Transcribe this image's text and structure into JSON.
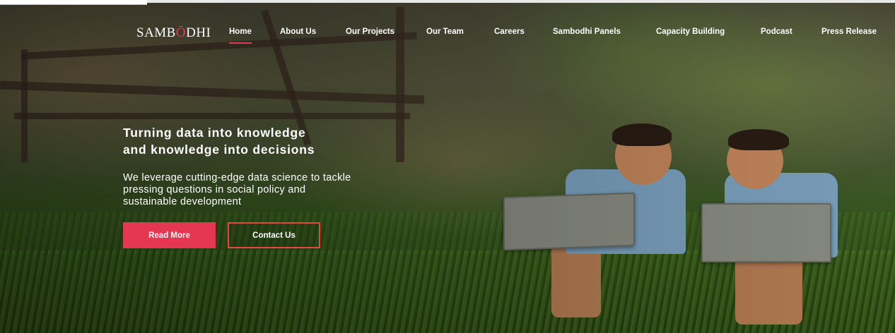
{
  "brand": {
    "logo_prefix": "SAMB",
    "logo_accent": "Ō",
    "logo_suffix": "DHI",
    "accent_color": "#e23b55"
  },
  "nav": {
    "items": [
      {
        "label": "Home",
        "active": true
      },
      {
        "label": "About Us",
        "active": false
      },
      {
        "label": "Our Projects",
        "active": false
      },
      {
        "label": "Our Team",
        "active": false
      },
      {
        "label": "Careers",
        "active": false
      },
      {
        "label": "Sambodhi Panels",
        "active": false
      },
      {
        "label": "Capacity Building",
        "active": false
      },
      {
        "label": "Podcast",
        "active": false
      },
      {
        "label": "Press Release",
        "active": false
      }
    ]
  },
  "hero": {
    "headline_line1": "Turning data into knowledge",
    "headline_line2": "and knowledge into decisions",
    "sub_line1": "We leverage cutting-edge data science to tackle",
    "sub_line2": "pressing questions in social policy and",
    "sub_line3": "sustainable development",
    "primary_button": "Read More",
    "secondary_button": "Contact Us",
    "primary_button_color": "#e63752",
    "secondary_border_color": "#e24a3c"
  }
}
